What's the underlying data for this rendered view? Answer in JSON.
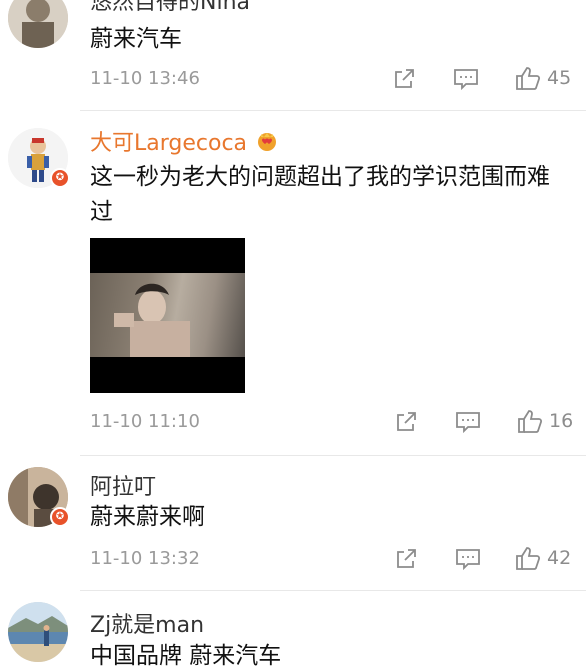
{
  "comments": [
    {
      "username": "悠然自得的Nina",
      "text": "蔚来汽车",
      "time": "11-10 13:46",
      "likes": "45",
      "verified": false,
      "avatar_icon": "portrait-avatar"
    },
    {
      "username": "大可Largecoca",
      "username_badge": "crown-heart-icon",
      "text": "这一秒为老大的问题超出了我的学识范围而难过",
      "time": "11-10 11:10",
      "likes": "16",
      "verified": true,
      "has_image": true,
      "avatar_icon": "cartoon-avatar"
    },
    {
      "username": "阿拉叮",
      "text": "蔚来蔚来啊",
      "time": "11-10 13:32",
      "likes": "42",
      "verified": true,
      "avatar_icon": "photo-avatar"
    },
    {
      "username": "Zj就是man",
      "text": "中国品牌 蔚来汽车",
      "verified": false,
      "avatar_icon": "beach-avatar"
    }
  ],
  "colors": {
    "accent_orange": "#e8772e",
    "verified_badge": "#e8522a",
    "meta_gray": "#9a9a9a"
  }
}
